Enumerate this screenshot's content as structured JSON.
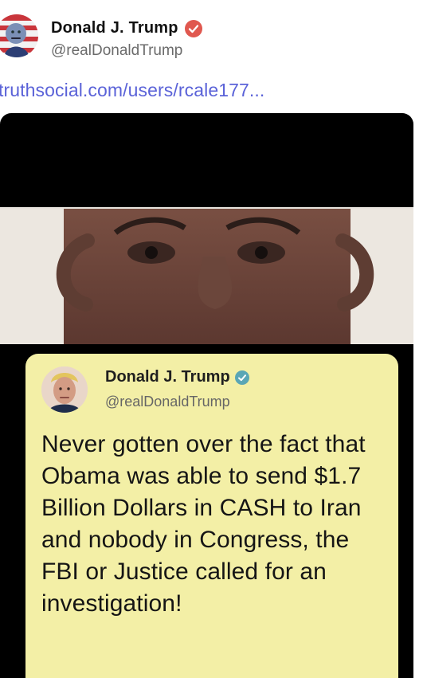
{
  "header": {
    "name": "Donald J. Trump",
    "handle": "@realDonaldTrump",
    "avatar_icon": "avatar-flag-portrait-icon",
    "verified_icon": "verified-badge-icon",
    "verified_color": "#e0584f"
  },
  "link": {
    "text": "truthsocial.com/users/rcale177..."
  },
  "media": {
    "image_icon": "portrait-photo",
    "quoted_tweet": {
      "name": "Donald J. Trump",
      "handle": "@realDonaldTrump",
      "avatar_icon": "avatar-portrait-icon",
      "verified_icon": "verified-badge-icon",
      "verified_color": "#5aa6b5",
      "text": "Never gotten over the fact that Obama was able to send $1.7 Billion Dollars in CASH to Iran and nobody in Congress, the FBI or Justice called for an investigation!",
      "background": "#f3efa6"
    }
  }
}
